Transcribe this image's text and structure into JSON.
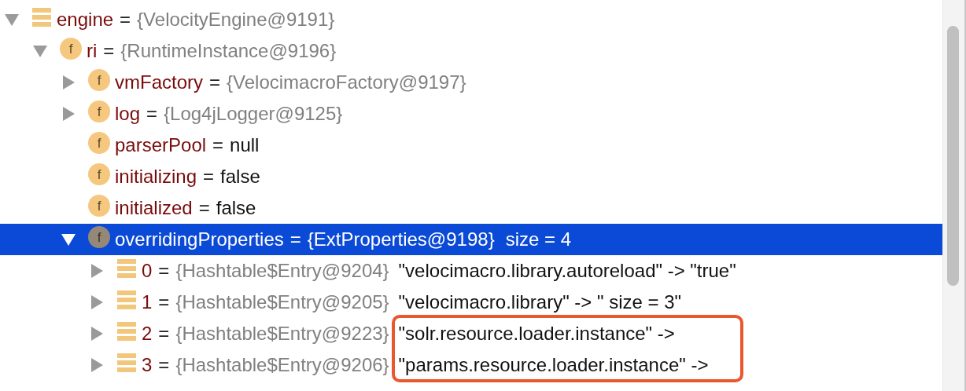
{
  "tree": [
    {
      "name": "engine",
      "separator": "=",
      "value": "{VelocityEngine@9191}",
      "kind": "list",
      "expanded": true,
      "selected": false,
      "children": [
        {
          "name": "ri",
          "separator": "=",
          "value": "{RuntimeInstance@9196}",
          "kind": "field",
          "icon_letter": "f",
          "expanded": true,
          "selected": false,
          "children": [
            {
              "name": "vmFactory",
              "separator": "=",
              "value": "{VelocimacroFactory@9197}",
              "kind": "field",
              "icon_letter": "f",
              "expanded": false,
              "selected": false
            },
            {
              "name": "log",
              "separator": "=",
              "value": "{Log4jLogger@9125}",
              "kind": "field",
              "icon_letter": "f",
              "expanded": false,
              "selected": false
            },
            {
              "name": "parserPool",
              "separator": "=",
              "literal": "null",
              "kind": "field",
              "icon_letter": "f",
              "selected": false
            },
            {
              "name": "initializing",
              "separator": "=",
              "literal": "false",
              "kind": "field",
              "icon_letter": "f",
              "selected": false
            },
            {
              "name": "initialized",
              "separator": "=",
              "literal": "false",
              "kind": "field",
              "icon_letter": "f",
              "selected": false
            },
            {
              "name": "overridingProperties",
              "separator": "=",
              "value": "{ExtProperties@9198}",
              "detail": "size = 4",
              "kind": "field-muted",
              "icon_letter": "f",
              "expanded": true,
              "selected": true,
              "children": [
                {
                  "name": "0",
                  "separator": "=",
                  "value": "{Hashtable$Entry@9204}",
                  "literal": "\"velocimacro.library.autoreload\" -> \"true\"",
                  "kind": "list",
                  "expanded": false,
                  "selected": false
                },
                {
                  "name": "1",
                  "separator": "=",
                  "value": "{Hashtable$Entry@9205}",
                  "literal": "\"velocimacro.library\" -> \" size = 3\"",
                  "kind": "list",
                  "expanded": false,
                  "selected": false
                },
                {
                  "name": "2",
                  "separator": "=",
                  "value": "{Hashtable$Entry@9223}",
                  "literal": "\"solr.resource.loader.instance\" ->",
                  "kind": "list",
                  "expanded": false,
                  "selected": false
                },
                {
                  "name": "3",
                  "separator": "=",
                  "value": "{Hashtable$Entry@9206}",
                  "literal": "\"params.resource.loader.instance\" ->",
                  "kind": "list",
                  "expanded": false,
                  "selected": false
                }
              ]
            }
          ]
        }
      ]
    }
  ]
}
